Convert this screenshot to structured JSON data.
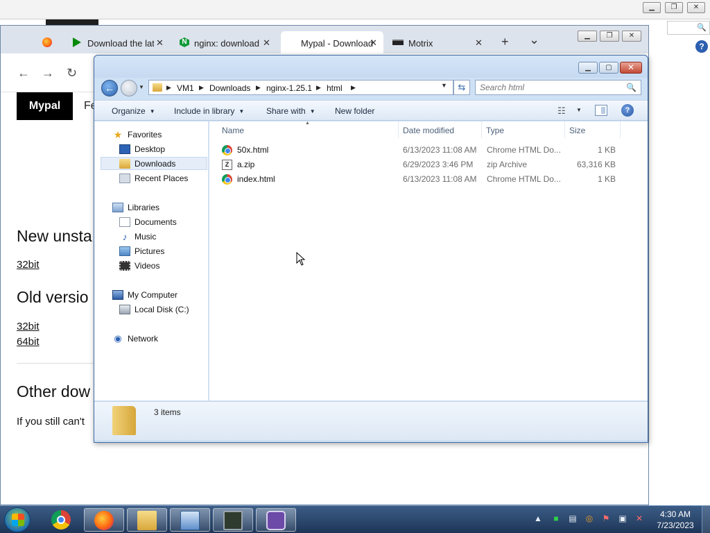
{
  "browser": {
    "tabs": [
      {
        "label": "",
        "icon": "firefox-icon"
      },
      {
        "label": "Download the late",
        "icon": "play-icon"
      },
      {
        "label": "nginx: download",
        "icon": "nginx-icon"
      },
      {
        "label": "Mypal - Download",
        "icon": "blank-icon",
        "active": true
      },
      {
        "label": "Motrix",
        "icon": "motrix-icon"
      }
    ],
    "new_tab": "+",
    "tab_list": "⌄"
  },
  "page": {
    "brand": "Mypal",
    "brand_next": "Fe",
    "h_new": "New unsta",
    "link_32_new": "32bit",
    "h_old": "Old versio",
    "link_32_old": "32bit",
    "link_64_old": "64bit",
    "h_other": "Other dow",
    "p_still": "If you still can't"
  },
  "explorer": {
    "breadcrumb": [
      "VM1",
      "Downloads",
      "nginx-1.25.1",
      "html"
    ],
    "search_placeholder": "Search html",
    "toolbar": {
      "organize": "Organize",
      "include": "Include in library",
      "share": "Share with",
      "new_folder": "New folder"
    },
    "nav": {
      "favorites": "Favorites",
      "desktop": "Desktop",
      "downloads": "Downloads",
      "recent": "Recent Places",
      "libraries": "Libraries",
      "documents": "Documents",
      "music": "Music",
      "pictures": "Pictures",
      "videos": "Videos",
      "computer": "My Computer",
      "local_disk": "Local Disk (C:)",
      "network": "Network"
    },
    "columns": {
      "name": "Name",
      "date": "Date modified",
      "type": "Type",
      "size": "Size"
    },
    "files": [
      {
        "name": "50x.html",
        "date": "6/13/2023 11:08 AM",
        "type": "Chrome HTML Do...",
        "size": "1 KB",
        "icon": "chrome-icon"
      },
      {
        "name": "a.zip",
        "date": "6/29/2023 3:46 PM",
        "type": "zip Archive",
        "size": "63,316 KB",
        "icon": "zip-icon"
      },
      {
        "name": "index.html",
        "date": "6/13/2023 11:08 AM",
        "type": "Chrome HTML Do...",
        "size": "1 KB",
        "icon": "chrome-icon"
      }
    ],
    "status": "3 items"
  },
  "taskbar": {
    "apps": [
      "chrome-icon",
      "firefox-icon",
      "explorer-folder-icon",
      "control-panel-icon",
      "terminal-icon",
      "app-icon"
    ],
    "time": "4:30 AM",
    "date": "7/23/2023"
  }
}
